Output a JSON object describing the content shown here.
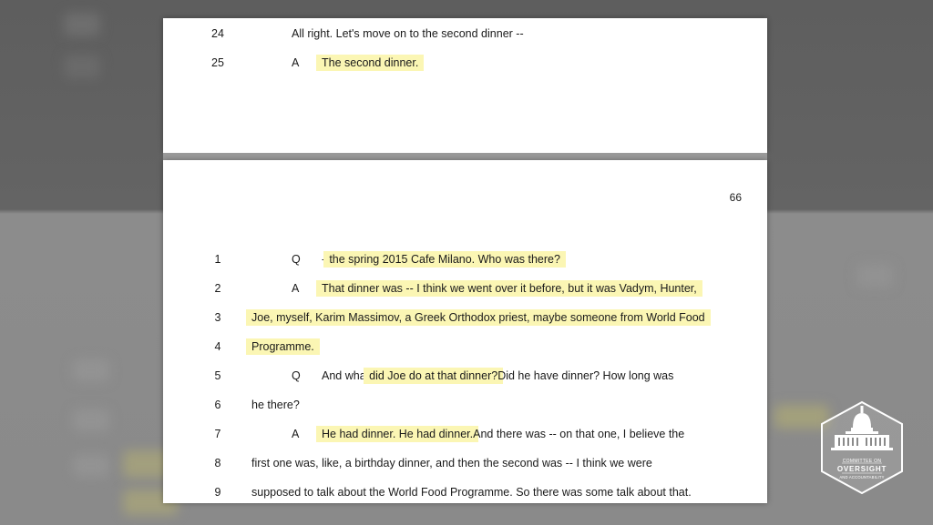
{
  "page_top": {
    "lines": [
      {
        "num": "24",
        "speaker": "",
        "text": "All right.   Let's move on to the second dinner --",
        "highlight": ""
      },
      {
        "num": "25",
        "speaker": "A",
        "text": "",
        "highlight": "The second dinner."
      }
    ]
  },
  "page_bottom": {
    "page_number": "66",
    "lines": [
      {
        "num": "1",
        "speaker": "Q",
        "pre": "-- ",
        "hl": "the spring 2015 Cafe Milano.    Who was there?",
        "post": ""
      },
      {
        "num": "2",
        "speaker": "A",
        "pre": "",
        "hl": "That dinner was -- I think we went over it before, but it was Vadym, Hunter,",
        "post": ""
      },
      {
        "num": "3",
        "speaker": "",
        "pre": "",
        "hl": "Joe, myself, Karim Massimov, a Greek Orthodox priest, maybe someone from World Food",
        "post": ""
      },
      {
        "num": "4",
        "speaker": "",
        "pre": "",
        "hl": "Programme.",
        "post": ""
      },
      {
        "num": "5",
        "speaker": "Q",
        "pre": "And what ",
        "hl": "did Joe do at that dinner?",
        "post": "   Did he have dinner?    How long was"
      },
      {
        "num": "6",
        "speaker": "",
        "pre": "he there?",
        "hl": "",
        "post": ""
      },
      {
        "num": "7",
        "speaker": "A",
        "pre": "",
        "hl": "He had dinner.    He had dinner.",
        "post": "   And there was -- on that one, I believe the"
      },
      {
        "num": "8",
        "speaker": "",
        "pre": "first one was, like, a birthday dinner, and then the second was -- I think we were",
        "hl": "",
        "post": ""
      },
      {
        "num": "9",
        "speaker": "",
        "pre": "supposed to talk about the World Food Programme.    So there was some talk about that.",
        "hl": "",
        "post": ""
      }
    ]
  },
  "logo": {
    "line1": "COMMITTEE ON",
    "line2": "OVERSIGHT",
    "line3": "AND ACCOUNTABILITY"
  }
}
